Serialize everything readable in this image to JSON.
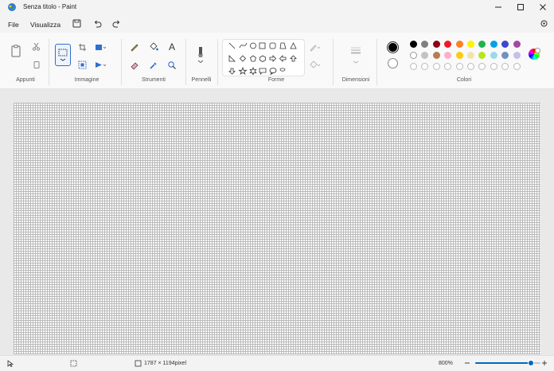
{
  "window": {
    "title": "Senza titolo - Paint"
  },
  "menu": {
    "file": "File",
    "view": "Visualizza"
  },
  "groups": {
    "clipboard": "Appunti",
    "image": "Immagine",
    "tools": "Strumenti",
    "brushes": "Pennelli",
    "shapes": "Forme",
    "size": "Dimensioni",
    "colors": "Colori"
  },
  "tools": {
    "text_glyph": "A"
  },
  "palette": {
    "row1": [
      "#000000",
      "#7f7f7f",
      "#880015",
      "#ed1c24",
      "#ff7f27",
      "#fff200",
      "#22b14c",
      "#00a2e8",
      "#3f48cc",
      "#a349a4"
    ],
    "row2": [
      "#ffffff",
      "#c3c3c3",
      "#b97a57",
      "#ffaec9",
      "#ffc90e",
      "#efe4b0",
      "#b5e61d",
      "#99d9ea",
      "#7092be",
      "#c8bfe7"
    ],
    "row3_empty_count": 10,
    "primary": "#000000",
    "secondary": "#ffffff"
  },
  "status": {
    "canvas_size": "1787 × 1194pixel",
    "zoom": "800%",
    "zoom_fraction": 0.85
  }
}
